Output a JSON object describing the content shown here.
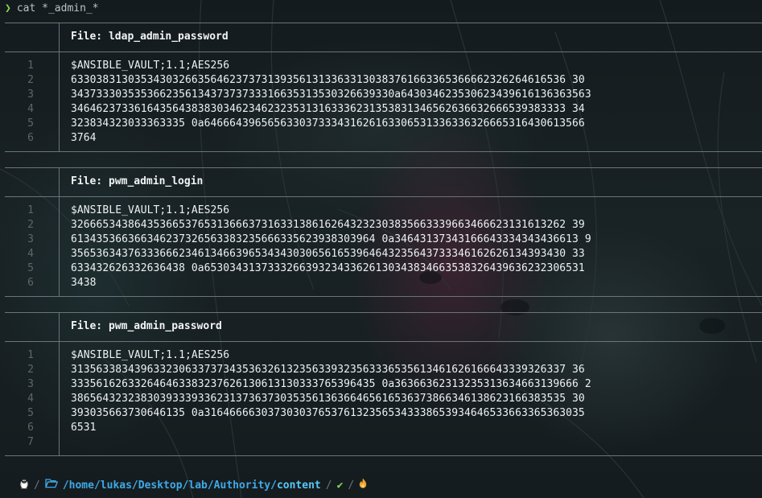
{
  "prompt": {
    "symbol": "❯",
    "command": "cat *_admin_*"
  },
  "files": [
    {
      "label": "File:",
      "name": "ldap_admin_password",
      "line_numbers": [
        "1",
        "2",
        "3",
        "4",
        "5",
        "6"
      ],
      "lines": [
        "$ANSIBLE_VAULT;1.1;AES256",
        "633038313035343032663564623737313935613133633130383761663365366662326264616536 30",
        "343733303535366235613437373733316635313530326639330a643034623530623439616136363563",
        "346462373361643564383830346234623235313163336231353831346562636632666539383333 34",
        "323834323033363335 0a646664396565633037333431626163306531336336326665316430613566",
        "3764"
      ]
    },
    {
      "label": "File:",
      "name": "pwm_admin_login",
      "line_numbers": [
        "1",
        "2",
        "3",
        "4",
        "5",
        "6"
      ],
      "lines": [
        "$ANSIBLE_VAULT;1.1;AES256",
        "326665343864353665376531366637316331386162643232303835663339663466623131613262 39",
        "613435366366346237326563383235666335623938303964 0a34643137343166643334343436613 9",
        "356536343763336662346134663965343430306561653964643235643733346162626134393430 33",
        "633432626332636438 0a653034313733326639323433626130343834663538326439636232306531",
        "3438"
      ]
    },
    {
      "label": "File:",
      "name": "pwm_admin_password",
      "line_numbers": [
        "1",
        "2",
        "3",
        "4",
        "5",
        "6",
        "7"
      ],
      "lines": [
        "$ANSIBLE_VAULT;1.1;AES256",
        "313563383439633230633737343536326132356339323563336535613461626166643339326337 36",
        "333561626332646463383237626130613130333765396435 0a36366362313235313634663139666 2",
        "386564323238303933393362313736373035356136366465616536373866346138623166383535 30",
        "393035663730646135 0a316466663037303037653761323565343338653934646533663365363035",
        "6531",
        ""
      ]
    }
  ],
  "status": {
    "os_icon": "linux-penguin-icon",
    "folder_icon": "folder-open-icon",
    "path_home": "/home",
    "path_rest": "/lukas/Desktop/lab/Authority/",
    "path_current": "content",
    "separator": "/",
    "ok_symbol": "✔",
    "fire_symbol": "🔥"
  },
  "colors": {
    "background": "#13191d",
    "prompt_arrow": "#8ad65a",
    "path": "#3fa9e6",
    "line_numbers": "#5d676b",
    "rules": "#6c7479"
  }
}
